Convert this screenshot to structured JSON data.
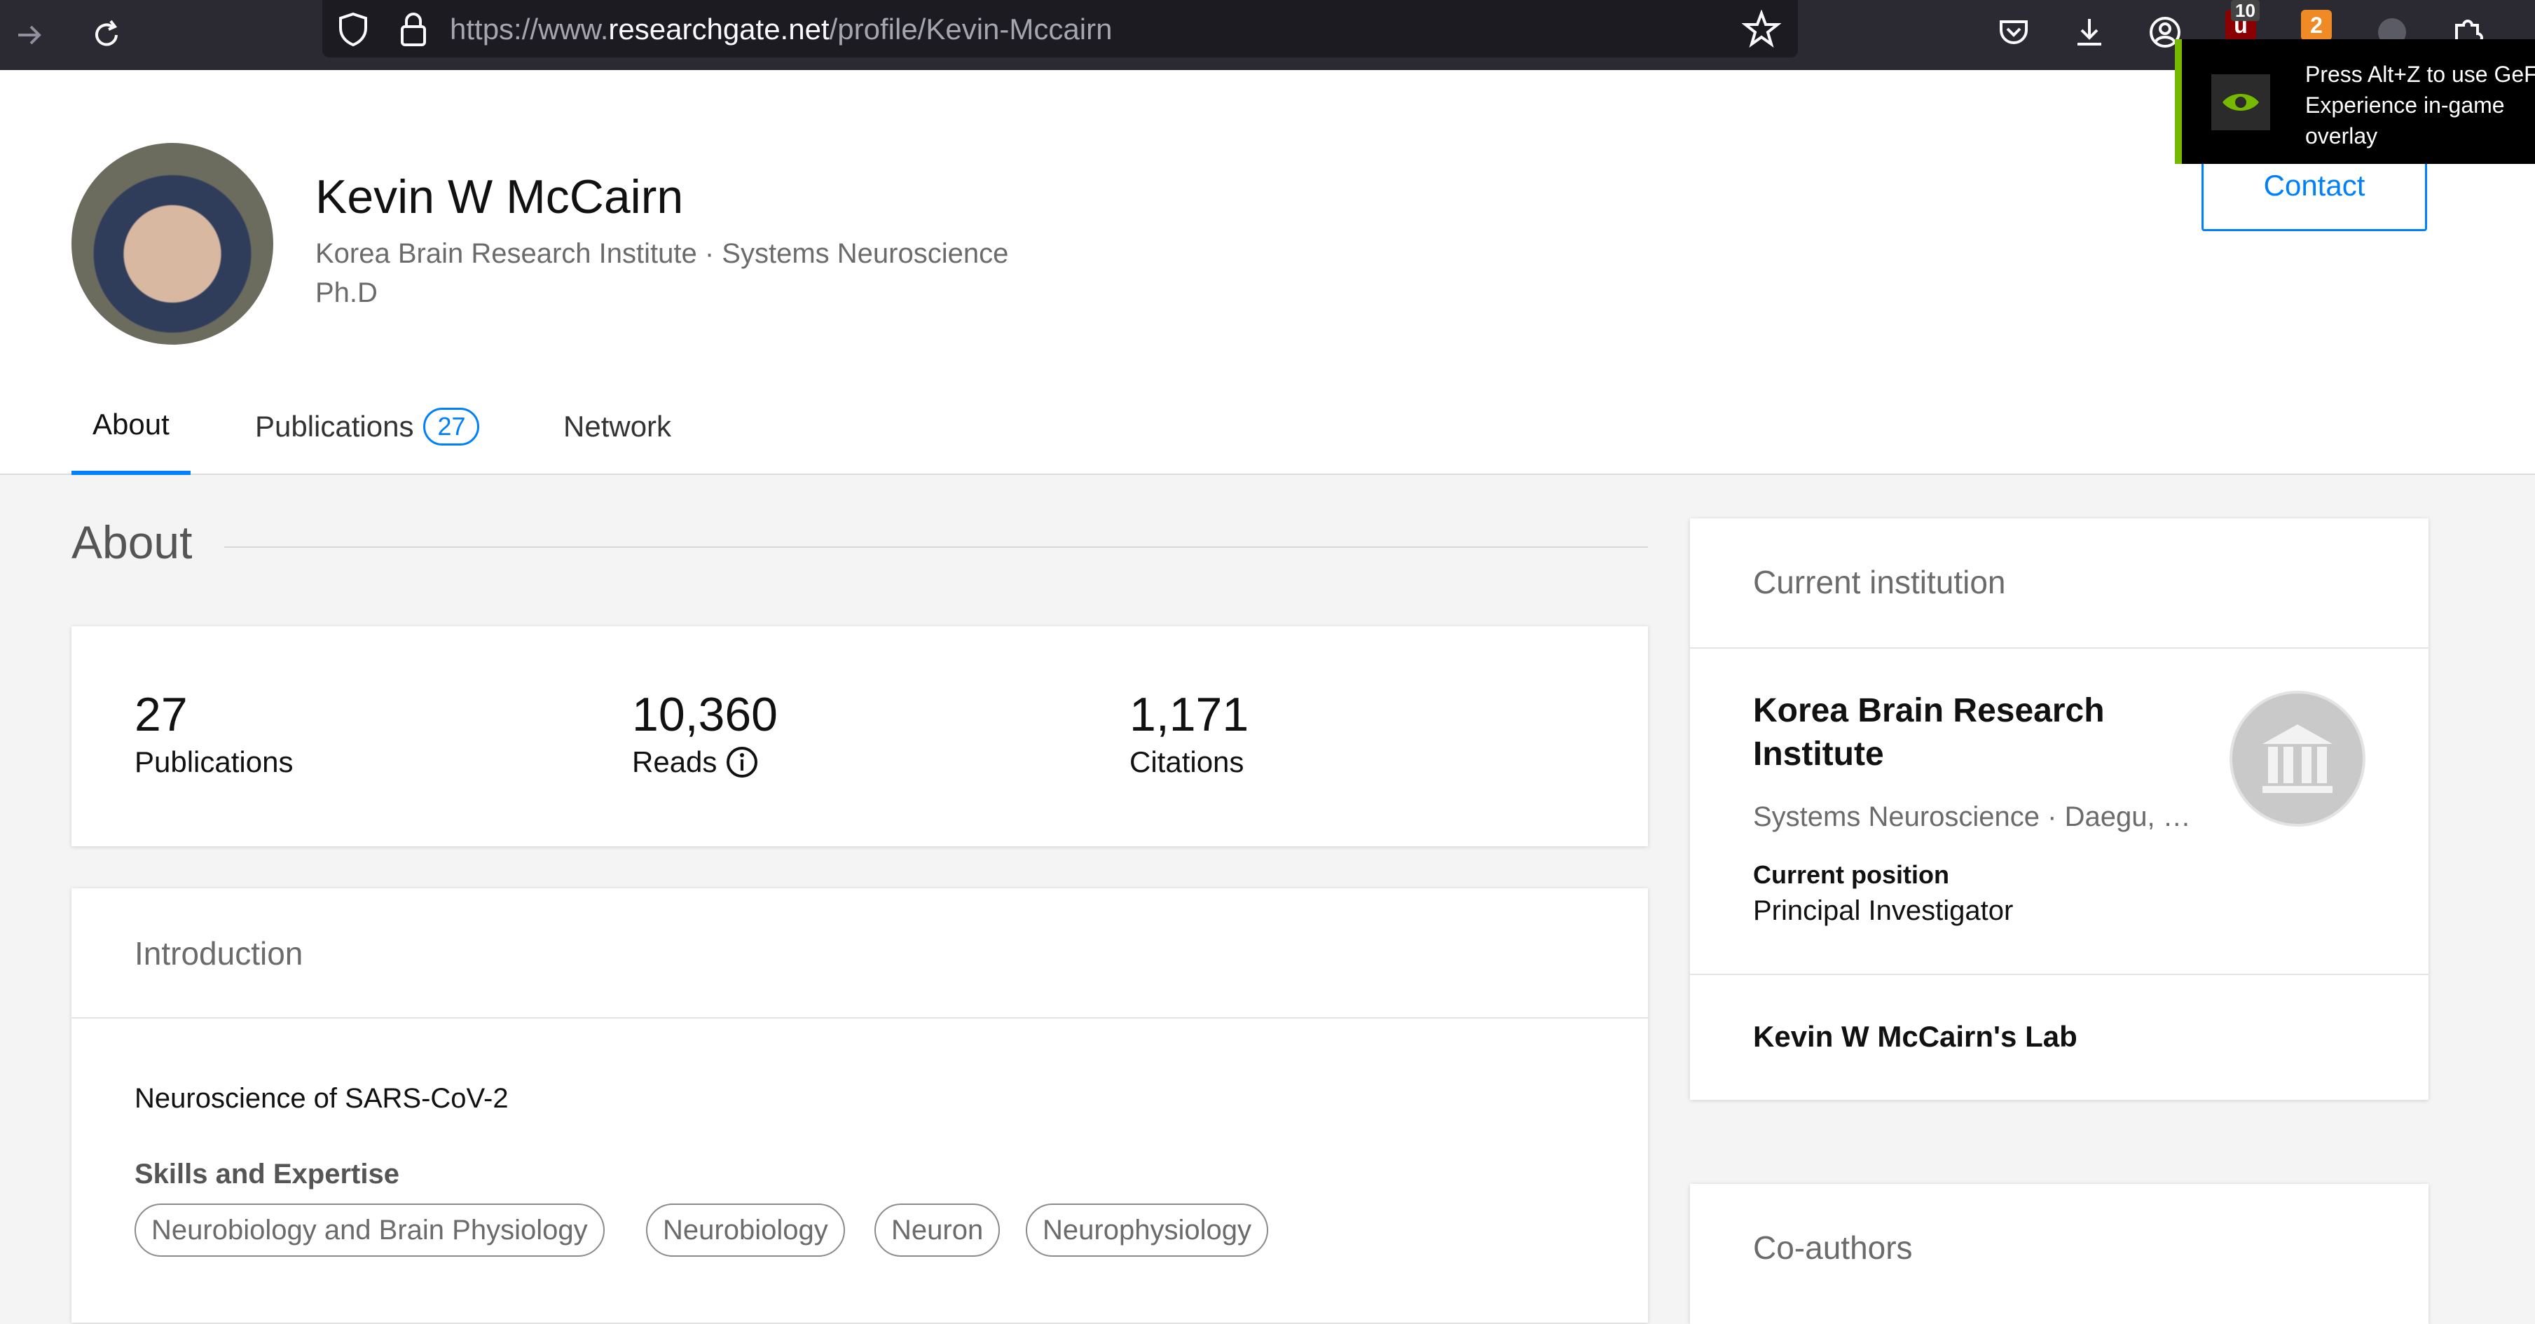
{
  "browser": {
    "url_prefix": "https://www.",
    "url_host": "researchgate.net",
    "url_path": "/profile/Kevin-Mccairn",
    "ext_count_badge": "10",
    "ext_orange_badge": "2"
  },
  "overlay": {
    "line1": "Press Alt+Z to use GeFo",
    "line2": "Experience in-game",
    "line3": "overlay"
  },
  "profile": {
    "name": "Kevin W McCairn",
    "affiliation": "Korea Brain Research Institute · Systems Neuroscience",
    "degree": "Ph.D",
    "contact_label": "Contact"
  },
  "tabs": [
    {
      "label": "About"
    },
    {
      "label": "Publications",
      "badge": "27"
    },
    {
      "label": "Network"
    }
  ],
  "about": {
    "title": "About",
    "stats": [
      {
        "value": "27",
        "label": "Publications"
      },
      {
        "value": "10,360",
        "label": "Reads"
      },
      {
        "value": "1,171",
        "label": "Citations"
      }
    ]
  },
  "introduction": {
    "title": "Introduction",
    "text": "Neuroscience of SARS-CoV-2",
    "skills_label": "Skills and Expertise",
    "skills": [
      "Neurobiology and Brain Physiology",
      "Neurobiology",
      "Neuron",
      "Neurophysiology"
    ]
  },
  "institution": {
    "title": "Current institution",
    "name": "Korea Brain Research Institute",
    "dept": "Systems Neuroscience · Daegu, South Korea",
    "position_label": "Current position",
    "position_value": "Principal Investigator",
    "lab": "Kevin W McCairn's Lab"
  },
  "coauthors": {
    "title": "Co-authors"
  },
  "colors": {
    "accent": "#0080ff",
    "nvidia_green": "#76b900"
  }
}
